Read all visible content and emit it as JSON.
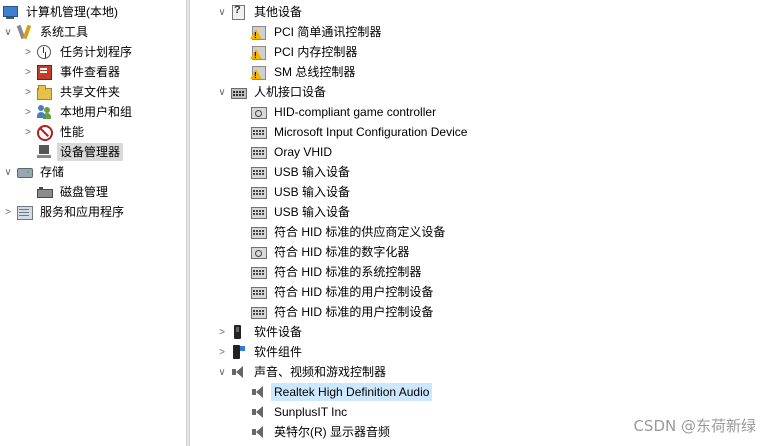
{
  "left_tree": {
    "items": [
      {
        "label": "计算机管理(本地)",
        "icon": "computer-icon",
        "toggle": "",
        "level": 0
      },
      {
        "label": "系统工具",
        "icon": "tools-icon",
        "toggle": "∨",
        "level": 1
      },
      {
        "label": "任务计划程序",
        "icon": "clock-icon",
        "toggle": ">",
        "level": 2
      },
      {
        "label": "事件查看器",
        "icon": "event-viewer-icon",
        "toggle": ">",
        "level": 2
      },
      {
        "label": "共享文件夹",
        "icon": "shared-folder-icon",
        "toggle": ">",
        "level": 2
      },
      {
        "label": "本地用户和组",
        "icon": "users-icon",
        "toggle": ">",
        "level": 2
      },
      {
        "label": "性能",
        "icon": "performance-icon",
        "toggle": ">",
        "level": 2
      },
      {
        "label": "设备管理器",
        "icon": "device-manager-icon",
        "toggle": "",
        "level": 2
      },
      {
        "label": "存储",
        "icon": "storage-icon",
        "toggle": "∨",
        "level": 1
      },
      {
        "label": "磁盘管理",
        "icon": "disk-icon",
        "toggle": "",
        "level": 2
      },
      {
        "label": "服务和应用程序",
        "icon": "services-icon",
        "toggle": ">",
        "level": 1
      }
    ],
    "selected_label": "设备管理器"
  },
  "device_tree": {
    "items": [
      {
        "label": "其他设备",
        "icon": "unknown-device-icon",
        "toggle": "∨",
        "level": 0
      },
      {
        "label": "PCI 简单通讯控制器",
        "icon": "warning-device-icon",
        "toggle": "",
        "level": 1
      },
      {
        "label": "PCI 内存控制器",
        "icon": "warning-device-icon",
        "toggle": "",
        "level": 1
      },
      {
        "label": "SM 总线控制器",
        "icon": "warning-device-icon",
        "toggle": "",
        "level": 1
      },
      {
        "label": "人机接口设备",
        "icon": "hid-icon",
        "toggle": "∨",
        "level": 0
      },
      {
        "label": "HID-compliant game controller",
        "icon": "hid-device-circle-icon",
        "toggle": "",
        "level": 1
      },
      {
        "label": "Microsoft Input Configuration Device",
        "icon": "hid-device-icon",
        "toggle": "",
        "level": 1
      },
      {
        "label": "Oray VHID",
        "icon": "hid-device-icon",
        "toggle": "",
        "level": 1
      },
      {
        "label": "USB 输入设备",
        "icon": "hid-device-icon",
        "toggle": "",
        "level": 1
      },
      {
        "label": "USB 输入设备",
        "icon": "hid-device-icon",
        "toggle": "",
        "level": 1
      },
      {
        "label": "USB 输入设备",
        "icon": "hid-device-icon",
        "toggle": "",
        "level": 1
      },
      {
        "label": "符合 HID 标准的供应商定义设备",
        "icon": "hid-device-icon",
        "toggle": "",
        "level": 1
      },
      {
        "label": "符合 HID 标准的数字化器",
        "icon": "hid-device-circle-icon",
        "toggle": "",
        "level": 1
      },
      {
        "label": "符合 HID 标准的系统控制器",
        "icon": "hid-device-icon",
        "toggle": "",
        "level": 1
      },
      {
        "label": "符合 HID 标准的用户控制设备",
        "icon": "hid-device-icon",
        "toggle": "",
        "level": 1
      },
      {
        "label": "符合 HID 标准的用户控制设备",
        "icon": "hid-device-icon",
        "toggle": "",
        "level": 1
      },
      {
        "label": "软件设备",
        "icon": "software-device-icon",
        "toggle": ">",
        "level": 0
      },
      {
        "label": "软件组件",
        "icon": "software-component-icon",
        "toggle": ">",
        "level": 0
      },
      {
        "label": "声音、视频和游戏控制器",
        "icon": "sound-icon",
        "toggle": "∨",
        "level": 0
      },
      {
        "label": "Realtek High Definition Audio",
        "icon": "sound-icon",
        "toggle": "",
        "level": 1
      },
      {
        "label": "SunplusIT Inc",
        "icon": "sound-icon",
        "toggle": "",
        "level": 1
      },
      {
        "label": "英特尔(R) 显示器音频",
        "icon": "sound-icon",
        "toggle": "",
        "level": 1
      }
    ],
    "selected_label": "Realtek High Definition Audio"
  },
  "watermark": "CSDN @东荷新绿",
  "colors": {
    "selection_gray": "#d9d9d9",
    "selection_blue": "#cce8ff",
    "splitter": "#e6e6e6"
  }
}
